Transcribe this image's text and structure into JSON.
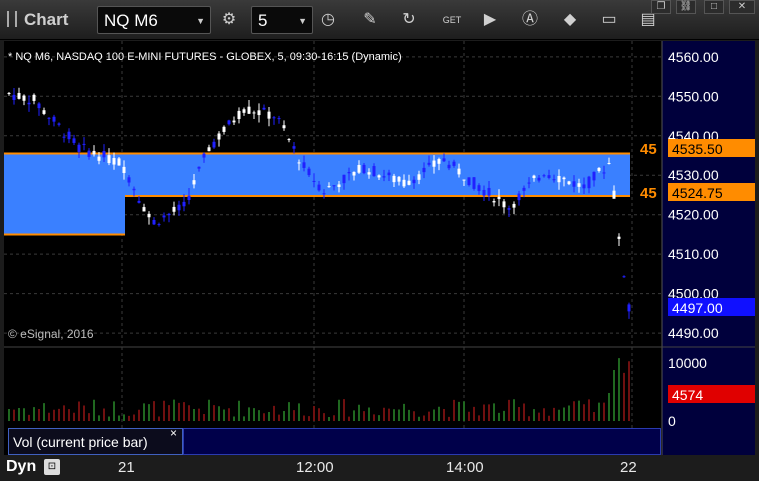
{
  "toolbar": {
    "title": "Chart",
    "symbol": "NQ M6",
    "interval": "5",
    "icons": [
      "settings-icon",
      "clock-icon",
      "pencil-icon",
      "refresh-icon",
      "get-icon",
      "play-icon",
      "alert-icon",
      "tag-icon",
      "chat-icon",
      "layout-icon"
    ]
  },
  "chart_header": "* NQ M6, NASDAQ 100 E-MINI FUTURES - GLOBEX, 5, 09:30-16:15 (Dynamic)",
  "copyright": "© eSignal, 2016",
  "price_axis": {
    "ticks": [
      "4560.00",
      "4550.00",
      "4540.00",
      "4530.00",
      "4520.00",
      "4510.00",
      "4500.00",
      "4490.00"
    ]
  },
  "price_badges": {
    "upper": {
      "left": "45",
      "value": "4535.50"
    },
    "lower": {
      "left": "45",
      "value": "4524.75"
    },
    "current": "4497.00"
  },
  "volume_axis": {
    "ticks": [
      "10000",
      "0"
    ],
    "current": "4574"
  },
  "study_label": "Vol (current price bar)",
  "time_axis": {
    "labels": [
      "21",
      "12:00",
      "14:00",
      "22"
    ]
  },
  "bottom": {
    "dyn": "Dyn"
  },
  "colors": {
    "up": "#ffffff",
    "down": "#2020ff",
    "band": "#3a80ff",
    "band_edge": "#ff8c00",
    "vol_up": "#40d040",
    "vol_down": "#e02020",
    "axis_bg": "#00003c"
  },
  "chart_data": {
    "type": "candlestick",
    "y_range": [
      4488,
      4563
    ],
    "bands": [
      {
        "low": 4515,
        "high": 4535.5
      },
      {
        "low": 4524.75,
        "high": 4535.5
      }
    ]
  }
}
